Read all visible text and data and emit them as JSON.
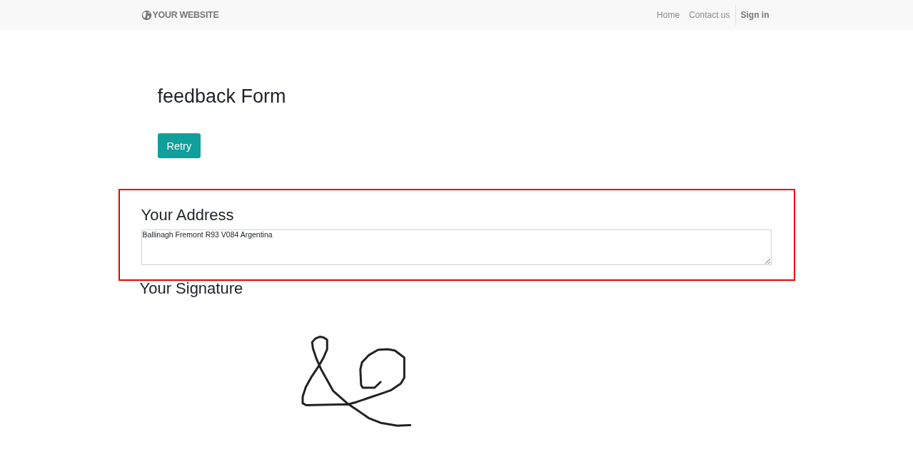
{
  "navbar": {
    "logo": "YOUR WEBSITE",
    "links": [
      {
        "label": "Home"
      },
      {
        "label": "Contact us"
      }
    ],
    "sign_in": "Sign in"
  },
  "page": {
    "title": "feedback Form",
    "retry_button": "Retry"
  },
  "address_section": {
    "highlighted": true,
    "heading": "Your Address",
    "value": "Ballinagh Fremont R93 V084 Argentina"
  },
  "signature_section": {
    "heading": "Your Signature"
  }
}
